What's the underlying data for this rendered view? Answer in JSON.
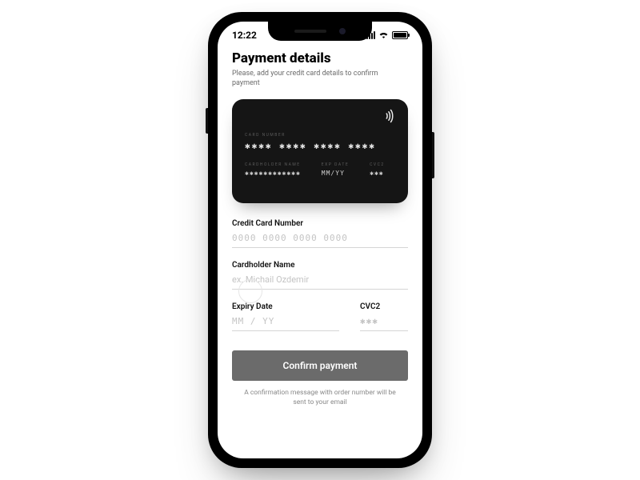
{
  "status": {
    "time": "12:22"
  },
  "header": {
    "title": "Payment details",
    "subtitle": "Please, add your credit card details to confirm payment"
  },
  "card": {
    "number_label": "CARD NUMBER",
    "number_mask": "✱✱✱✱ ✱✱✱✱ ✱✱✱✱ ✱✱✱✱",
    "holder_label": "CARDHOLDER NAME",
    "holder_mask": "✱✱✱✱✱✱✱✱✱✱✱✱",
    "exp_label": "EXP DATE",
    "exp_mask": "MM/YY",
    "cvc_label": "CVC2",
    "cvc_mask": "✱✱✱"
  },
  "form": {
    "cc_label": "Credit Card Number",
    "cc_placeholder": "0000 0000 0000 0000",
    "name_label": "Cardholder Name",
    "name_placeholder": "ex. Michail Ozdemir",
    "exp_label": "Expiry Date",
    "exp_placeholder": "MM / YY",
    "cvc_label": "CVC2",
    "cvc_placeholder": "✱✱✱"
  },
  "cta": {
    "confirm": "Confirm payment"
  },
  "footer": {
    "note": "A confirmation message with order number will be sent to your email"
  }
}
